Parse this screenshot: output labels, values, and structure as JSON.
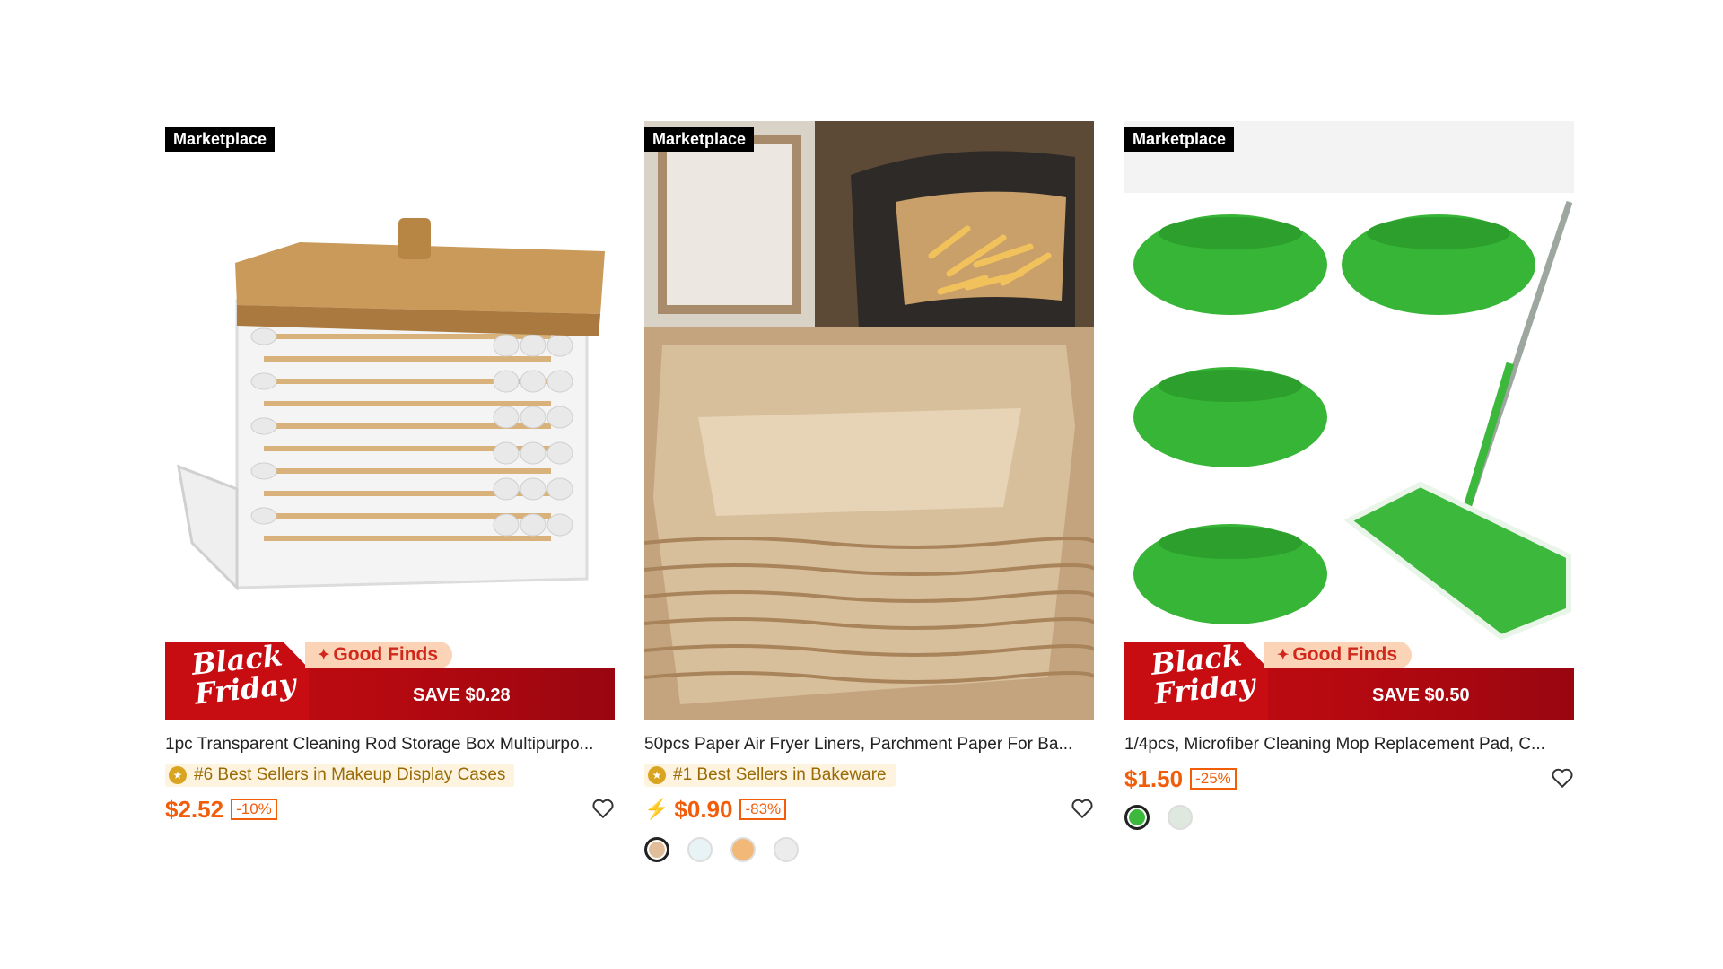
{
  "products": [
    {
      "badge": "Marketplace",
      "promo": {
        "title_line1": "Black",
        "title_line2": "Friday",
        "tag": "Good Finds",
        "save": "SAVE $0.28"
      },
      "title": "1pc Transparent Cleaning Rod Storage Box Multipurpo...",
      "seller_rank": "#6 Best Sellers in Makeup Display Cases",
      "price": "$2.52",
      "discount": "-10%"
    },
    {
      "badge": "Marketplace",
      "title": "50pcs Paper Air Fryer Liners, Parchment Paper For Ba...",
      "seller_rank": "#1 Best Sellers in Bakeware",
      "price": "$0.90",
      "discount": "-83%",
      "swatch_colors": [
        "#e2bd99",
        "#e8f3f6",
        "#f2b878",
        "#ececec"
      ]
    },
    {
      "badge": "Marketplace",
      "promo": {
        "title_line1": "Black",
        "title_line2": "Friday",
        "tag": "Good Finds",
        "save": "SAVE $0.50"
      },
      "title": "1/4pcs, Microfiber Cleaning Mop Replacement Pad, C...",
      "price": "$1.50",
      "discount": "-25%",
      "swatch_colors": [
        "#3cb83c",
        "#dfe8df"
      ]
    }
  ],
  "icons": {
    "favorite": "heart-outline-icon",
    "flash": "lightning-icon",
    "rank": "medal-icon",
    "spark": "sparkle-icon"
  },
  "colors": {
    "price": "#f25d0a",
    "promo_red": "#c80d12",
    "seller_bg": "#fdf3df"
  }
}
